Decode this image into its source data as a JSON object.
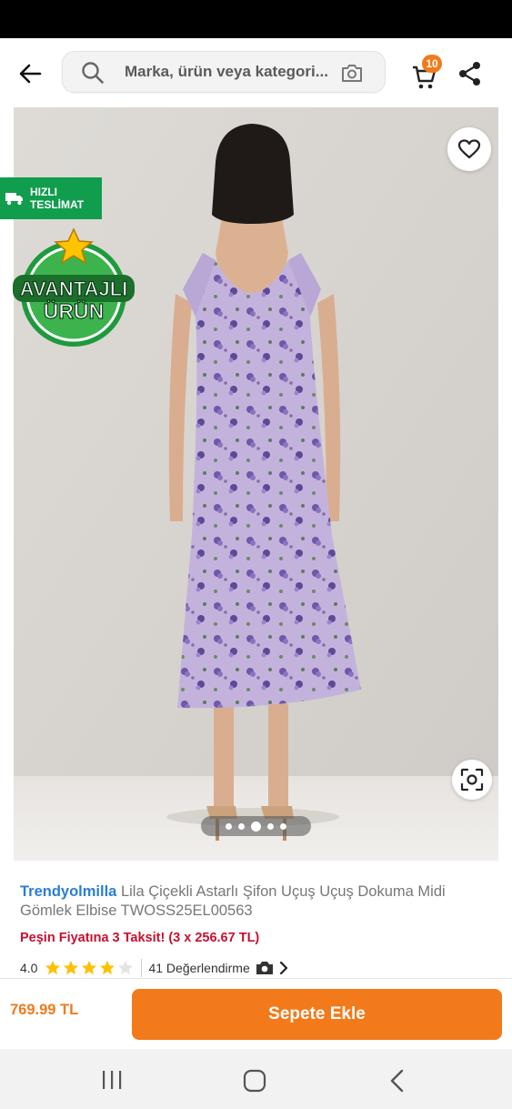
{
  "search": {
    "placeholder": "Marka, ürün veya kategori..."
  },
  "cart": {
    "badge_count": "10"
  },
  "labels": {
    "fast_delivery_line1": "HIZLI",
    "fast_delivery_line2": "TESLİMAT",
    "advantage_line1": "AVANTAJLI",
    "advantage_line2": "ÜRÜN"
  },
  "carousel": {
    "dot_count": 5,
    "active_index": 2
  },
  "product": {
    "brand": "Trendyolmilla",
    "name": " Lila Çiçekli Astarlı Şifon Uçuş Uçuş Dokuma Midi Gömlek Elbise TWOSS25EL00563",
    "installment": "Peşin Fiyatına 3 Taksit! (3 x 256.67 TL)",
    "rating": "4.0",
    "rating_stars_filled": 4,
    "rating_stars_total": 5,
    "reviews": "41 Değerlendirme"
  },
  "bottom": {
    "price": "769.99 TL",
    "add_button": "Sepete Ekle"
  },
  "colors": {
    "accent": "#f27a1a",
    "brand_link": "#2b7ed7",
    "installment": "#c8102e",
    "fast_delivery": "#109d4d"
  },
  "icons": [
    "back-arrow-icon",
    "search-icon",
    "camera-search-icon",
    "cart-icon",
    "share-icon",
    "heart-icon",
    "truck-icon",
    "star-icon",
    "lens-icon",
    "camera-icon",
    "chevron-right-icon",
    "recent-apps-icon",
    "home-icon",
    "nav-back-icon"
  ]
}
